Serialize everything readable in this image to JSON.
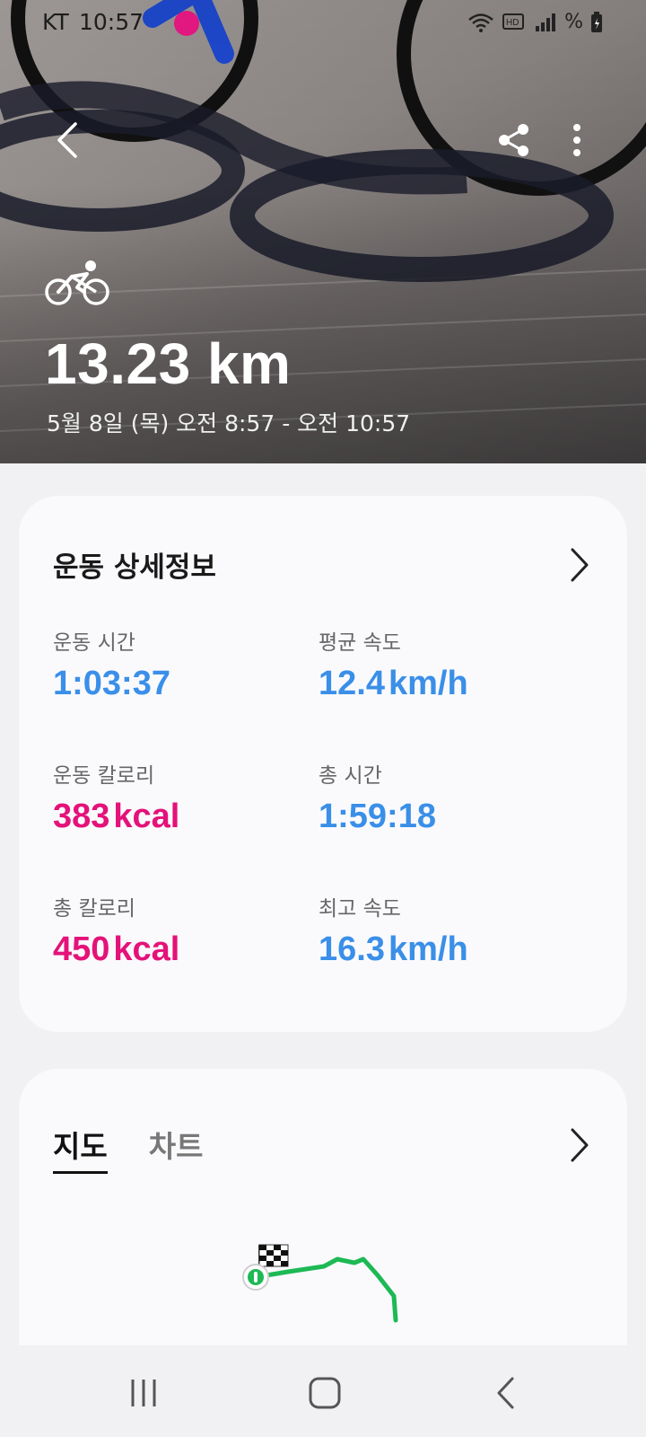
{
  "status_bar": {
    "carrier": "KT",
    "time": "10:57",
    "percent_symbol": "%"
  },
  "header": {
    "icons": [
      "back-arrow-icon",
      "share-icon",
      "more-options-icon",
      "bike-icon"
    ],
    "distance": "13.23 km",
    "date_range": "5월 8일 (목) 오전 8:57 - 오전 10:57"
  },
  "details": {
    "title": "운동 상세정보",
    "stats": [
      {
        "label": "운동 시간",
        "value": "1:03:37",
        "unit": "",
        "color": "#3a8fe8"
      },
      {
        "label": "평균 속도",
        "value": "12.4",
        "unit": "km/h",
        "color": "#3a8fe8"
      },
      {
        "label": "운동 칼로리",
        "value": "383",
        "unit": "kcal",
        "color": "#e41279"
      },
      {
        "label": "총 시간",
        "value": "1:59:18",
        "unit": "",
        "color": "#3a8fe8"
      },
      {
        "label": "총 칼로리",
        "value": "450",
        "unit": "kcal",
        "color": "#e41279"
      },
      {
        "label": "최고 속도",
        "value": "16.3",
        "unit": "km/h",
        "color": "#3a8fe8"
      }
    ]
  },
  "map_card": {
    "tabs": [
      {
        "label": "지도",
        "active": true
      },
      {
        "label": "차트",
        "active": false
      }
    ],
    "route_color": "#1db954"
  },
  "nav_bar": {
    "icons": [
      "recent-apps-icon",
      "home-icon",
      "back-icon"
    ]
  }
}
